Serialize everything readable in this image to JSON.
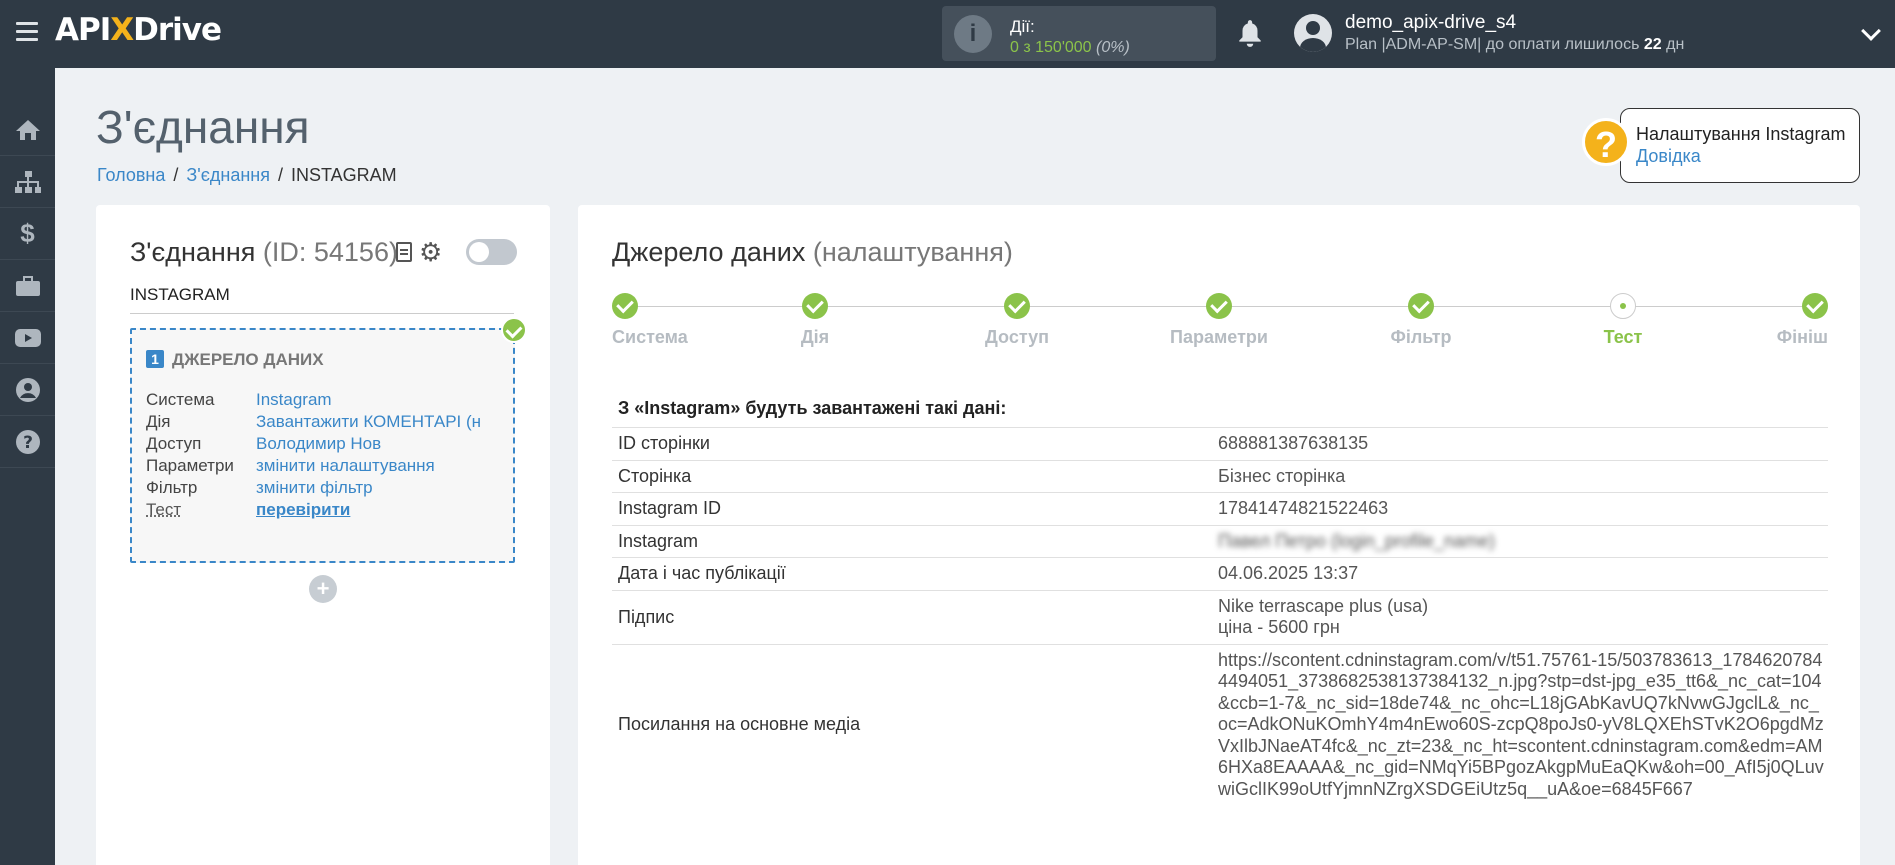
{
  "header": {
    "logo": {
      "part1": "API",
      "part2": "X",
      "part3": "Drive"
    },
    "actions": {
      "label": "Дії:",
      "value": "0 з 150'000",
      "percent": "(0%)"
    },
    "user": {
      "name": "demo_apix-drive_s4",
      "plan_prefix": "Plan |ADM-AP-SM| до оплати лишилось ",
      "days": "22",
      "days_suffix": " дн"
    }
  },
  "page": {
    "title": "З'єднання",
    "breadcrumb": [
      "Головна",
      "З'єднання",
      "INSTAGRAM"
    ]
  },
  "help": {
    "title": "Налаштування Instagram",
    "link": "Довідка"
  },
  "left_card": {
    "title": "З'єднання",
    "id_text": "(ID: 54156)",
    "name": "INSTAGRAM",
    "source": {
      "number": "1",
      "heading": "ДЖЕРЕЛО ДАНИХ",
      "rows": [
        {
          "key": "Система",
          "value": "Instagram"
        },
        {
          "key": "Дія",
          "value": "Завантажити КОМЕНТАРІ (н"
        },
        {
          "key": "Доступ",
          "value": "Володимир Нов"
        },
        {
          "key": "Параметри",
          "value": "змінити налаштування"
        },
        {
          "key": "Фільтр",
          "value": "змінити фільтр"
        },
        {
          "key": "Тест",
          "value": "перевірити"
        }
      ]
    },
    "add_label": "+"
  },
  "right_card": {
    "title": "Джерело даних",
    "subtitle": "(налаштування)",
    "steps": [
      "Система",
      "Дія",
      "Доступ",
      "Параметри",
      "Фільтр",
      "Тест",
      "Фініш"
    ],
    "current_step": "Тест",
    "table_heading": "З «Instagram» будуть завантажені такі дані:",
    "rows": [
      {
        "key": "ID сторінки",
        "value": "688881387638135"
      },
      {
        "key": "Сторінка",
        "value": "Бізнес сторінка"
      },
      {
        "key": "Instagram ID",
        "value": "17841474821522463"
      },
      {
        "key": "Instagram",
        "value": "Павел Петро (login_profile_name)"
      },
      {
        "key": "Дата і час публікації",
        "value": "04.06.2025 13:37"
      },
      {
        "key": "Підпис",
        "value": "Nike terrascape plus (usa)\nціна - 5600 грн"
      },
      {
        "key": "Посилання на основне медіа",
        "value": "https://scontent.cdninstagram.com/v/t51.75761-15/503783613_17846207844494051_3738682538137384132_n.jpg?stp=dst-jpg_e35_tt6&_nc_cat=104&ccb=1-7&_nc_sid=18de74&_nc_ohc=L18jGAbKavUQ7kNvwGJgclL&_nc_oc=AdkONuKOmhY4m4nEwo60S-zcpQ8poJs0-yV8LQXEhSTvK2O6pgdMzVxIlbJNaeAT4fc&_nc_zt=23&_nc_ht=scontent.cdninstagram.com&edm=AM6HXa8EAAAA&_nc_gid=NMqYi5BPgozAkgpMuEaQKw&oh=00_AfI5j0QLuvwiGclIK99oUtfYjmnNZrgXSDGEiUtz5q__uA&oe=6845F667"
      }
    ]
  },
  "colors": {
    "topbar": "#2f3a45",
    "accent_green": "#8bc34a",
    "link_blue": "#3a87c8",
    "logo_x": "#f4b21b"
  }
}
